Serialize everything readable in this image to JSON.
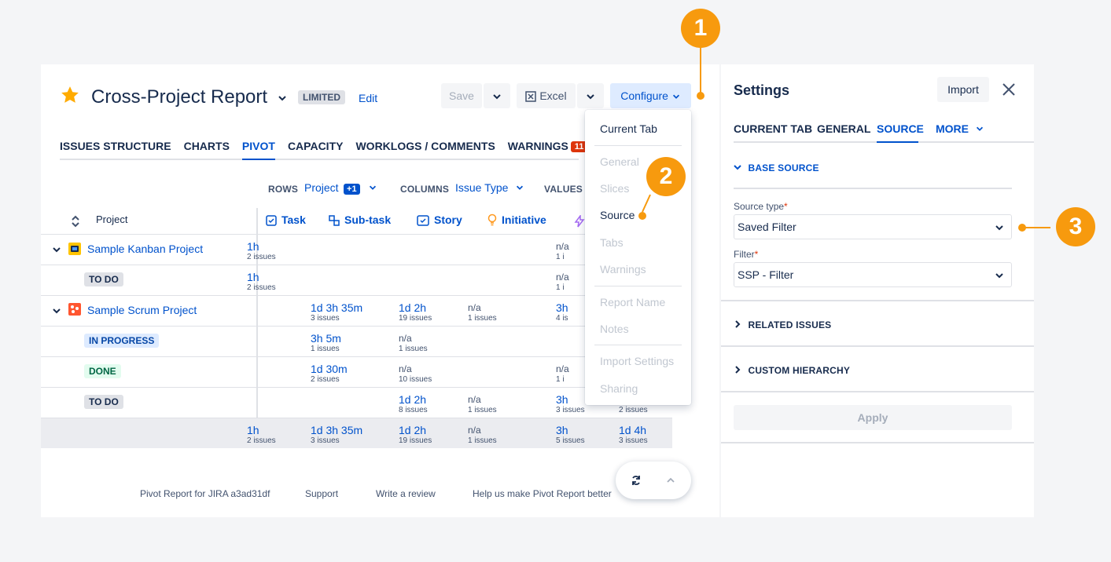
{
  "header": {
    "title": "Cross-Project Report",
    "lozenge": "LIMITED",
    "edit_label": "Edit",
    "save_label": "Save",
    "excel_label": "Excel",
    "configure_label": "Configure"
  },
  "tabs": [
    {
      "label": "ISSUES STRUCTURE"
    },
    {
      "label": "CHARTS"
    },
    {
      "label": "PIVOT"
    },
    {
      "label": "CAPACITY"
    },
    {
      "label": "WORKLOGS / COMMENTS"
    },
    {
      "label": "WARNINGS",
      "badge": "11"
    }
  ],
  "controls": {
    "rows_label": "ROWS",
    "rows_value": "Project",
    "rows_extra": "+1",
    "columns_label": "COLUMNS",
    "columns_value": "Issue Type",
    "values_label": "VALUES"
  },
  "table": {
    "project_header": "Project",
    "columns": [
      "Task",
      "Sub-task",
      "Story",
      "Initiative"
    ],
    "rows": [
      {
        "label": "Sample Kanban Project",
        "c1v": "1h",
        "c1s": "2 issues",
        "c5v": "n/a",
        "c5s": "1 i"
      },
      {
        "label": "TO DO",
        "c1v": "1h",
        "c1s": "2 issues",
        "c5v": "n/a",
        "c5s": "1 i"
      },
      {
        "label": "Sample Scrum Project",
        "c2v": "1d 3h 35m",
        "c2s": "3 issues",
        "c3v": "1d 2h",
        "c3s": "19 issues",
        "c4v": "n/a",
        "c4s": "1 issues",
        "c5v": "3h",
        "c5s": "4 is"
      },
      {
        "label": "IN PROGRESS",
        "c2v": "3h 5m",
        "c2s": "1 issues",
        "c3v": "n/a",
        "c3s": "1 issues"
      },
      {
        "label": "DONE",
        "c2v": "1d 30m",
        "c2s": "2 issues",
        "c3v": "n/a",
        "c3s": "10 issues",
        "c5v": "n/a",
        "c5s": "1 i"
      },
      {
        "label": "TO DO",
        "c3v": "1d 2h",
        "c3s": "8 issues",
        "c4v": "n/a",
        "c4s": "1 issues",
        "c5v": "3h",
        "c5s": "3 issues",
        "c6s": "2 issues"
      },
      {
        "c1v": "1h",
        "c1s": "2 issues",
        "c2v": "1d 3h 35m",
        "c2s": "3 issues",
        "c3v": "1d 2h",
        "c3s": "19 issues",
        "c4v": "n/a",
        "c4s": "1 issues",
        "c5v": "3h",
        "c5s": "5 issues",
        "c6v": "1d 4h",
        "c6s": "3 issues"
      }
    ]
  },
  "footer": {
    "version": "Pivot Report for JIRA a3ad31df",
    "support": "Support",
    "review": "Write a review",
    "help": "Help us make Pivot Report better"
  },
  "menu": {
    "items": [
      "Current Tab",
      "General",
      "Slices",
      "Source",
      "Tabs",
      "Warnings",
      "Report Name",
      "Notes",
      "Import Settings",
      "Sharing"
    ]
  },
  "settings": {
    "title": "Settings",
    "import_label": "Import",
    "tabs": [
      "CURRENT TAB",
      "GENERAL",
      "SOURCE",
      "MORE"
    ],
    "base_source": "BASE SOURCE",
    "source_type_label": "Source type",
    "source_type_value": "Saved Filter",
    "filter_label": "Filter",
    "filter_value": "SSP - Filter",
    "related_issues": "RELATED ISSUES",
    "custom_hierarchy": "CUSTOM HIERARCHY",
    "apply_label": "Apply",
    "required_mark": "*"
  },
  "callouts": [
    "1",
    "2",
    "3"
  ],
  "colors": {
    "accent": "#0052cc",
    "callout": "#f79a0e",
    "warning_badge": "#de350b"
  }
}
